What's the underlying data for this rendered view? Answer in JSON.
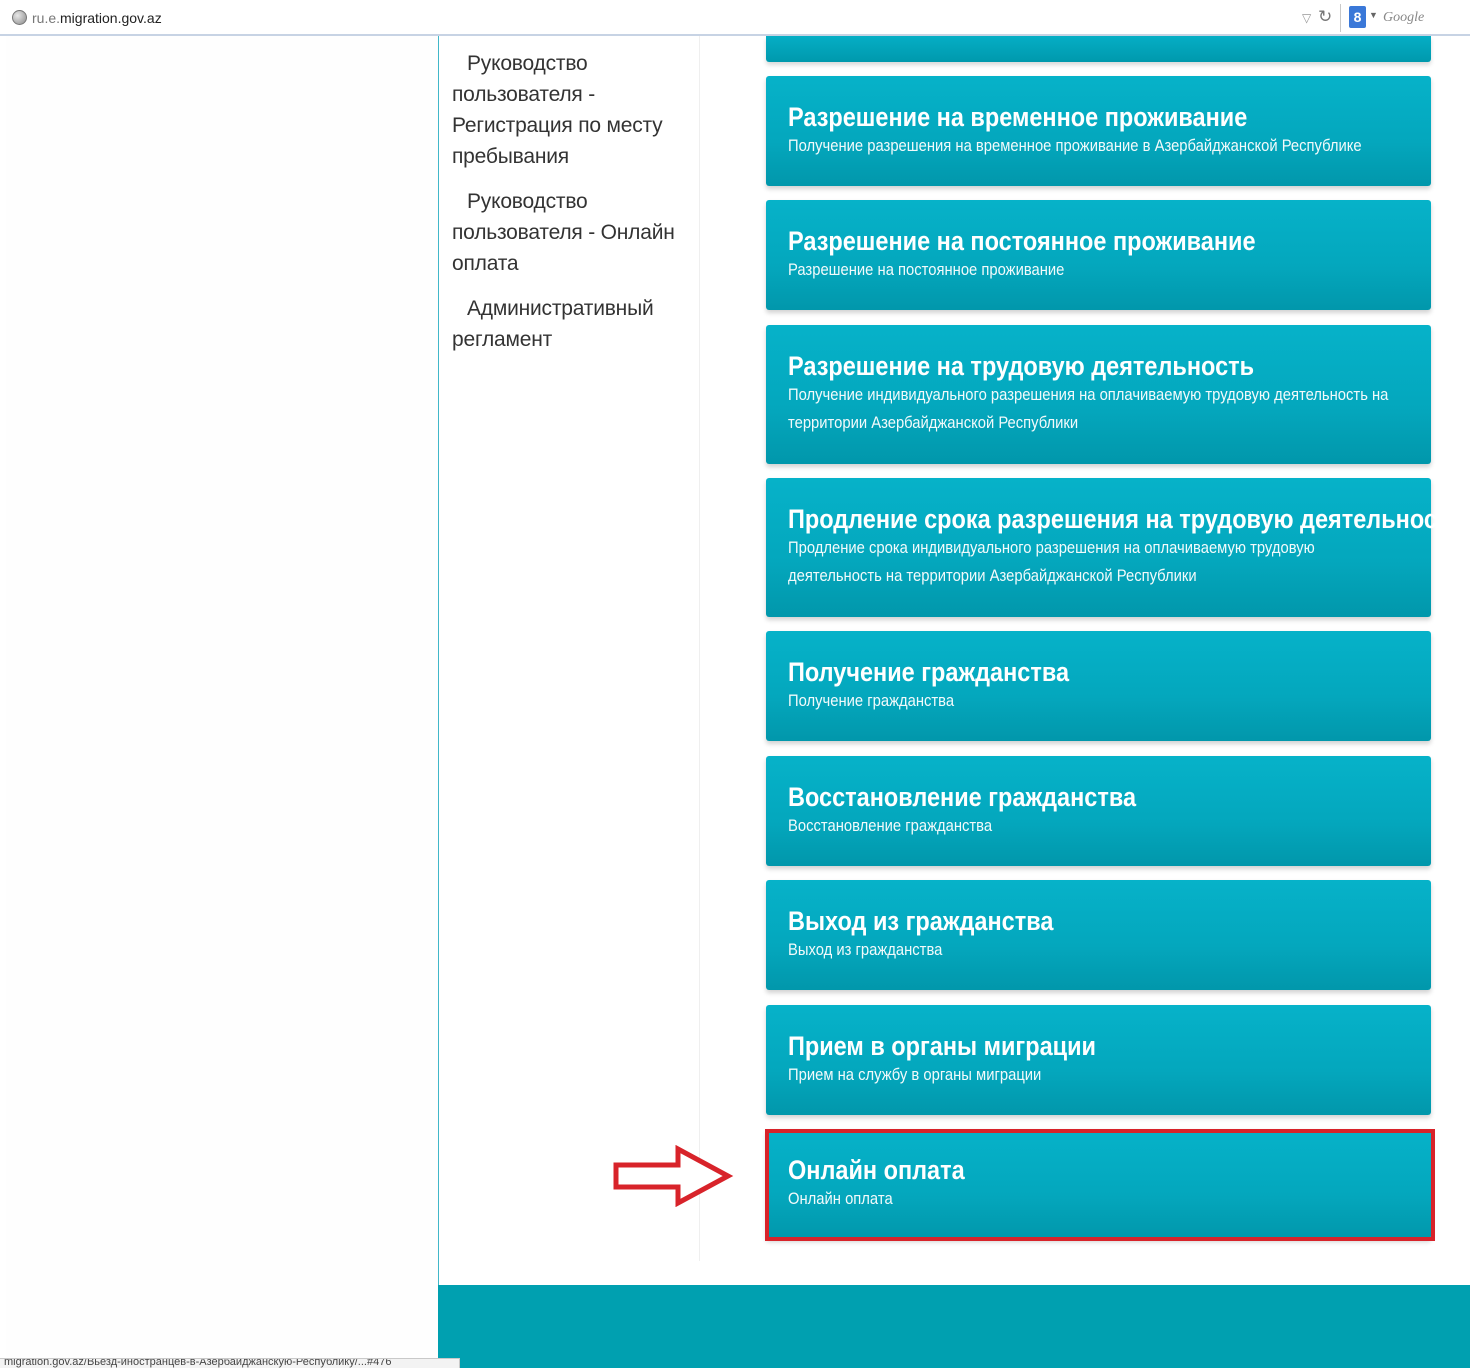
{
  "browser": {
    "url_prefix": "ru.e.",
    "url_domain": "migration.gov.az",
    "search_placeholder": "Google",
    "search_engine_icon": "8",
    "status_text": "migration.gov.az/Вьезд-иностранцев-в-Азербайджанскую-Республику/...#476"
  },
  "sidebar": {
    "items": [
      {
        "label": "Руководство пользователя - Регистрация по месту пребывания"
      },
      {
        "label": "Руководство пользователя - Онлайн оплата"
      },
      {
        "label": "Административный регламент"
      }
    ]
  },
  "services": [
    {
      "title": "Разрешение на временное проживание",
      "desc": "Получение разрешения на временное проживание в Азербайджанской Республике"
    },
    {
      "title": "Разрешение на постоянное проживание",
      "desc": "Разрешение на постоянное проживание"
    },
    {
      "title": "Разрешение на трудовую деятельность",
      "desc": "Получение индивидуального разрешения на оплачиваемую трудовую деятельность на территории Азербайджанской Республики"
    },
    {
      "title": "Продление срока разрешения на трудовую деятельность",
      "desc": "Продление срока индивидуального разрешения на оплачиваемую трудовую деятельность на территории Азербайджанской Республики"
    },
    {
      "title": "Получение гражданства",
      "desc": "Получение гражданства"
    },
    {
      "title": "Восстановление гражданства",
      "desc": "Восстановление гражданства"
    },
    {
      "title": "Выход из гражданства",
      "desc": "Выход из гражданства"
    },
    {
      "title": "Прием в органы миграции",
      "desc": "Прием на службу в органы миграции"
    },
    {
      "title": "Онлайн оплата",
      "desc": "Онлайн оплата"
    }
  ],
  "colors": {
    "card": "#04a7bd",
    "footer": "#00a0b0",
    "highlight": "#d8232a"
  }
}
